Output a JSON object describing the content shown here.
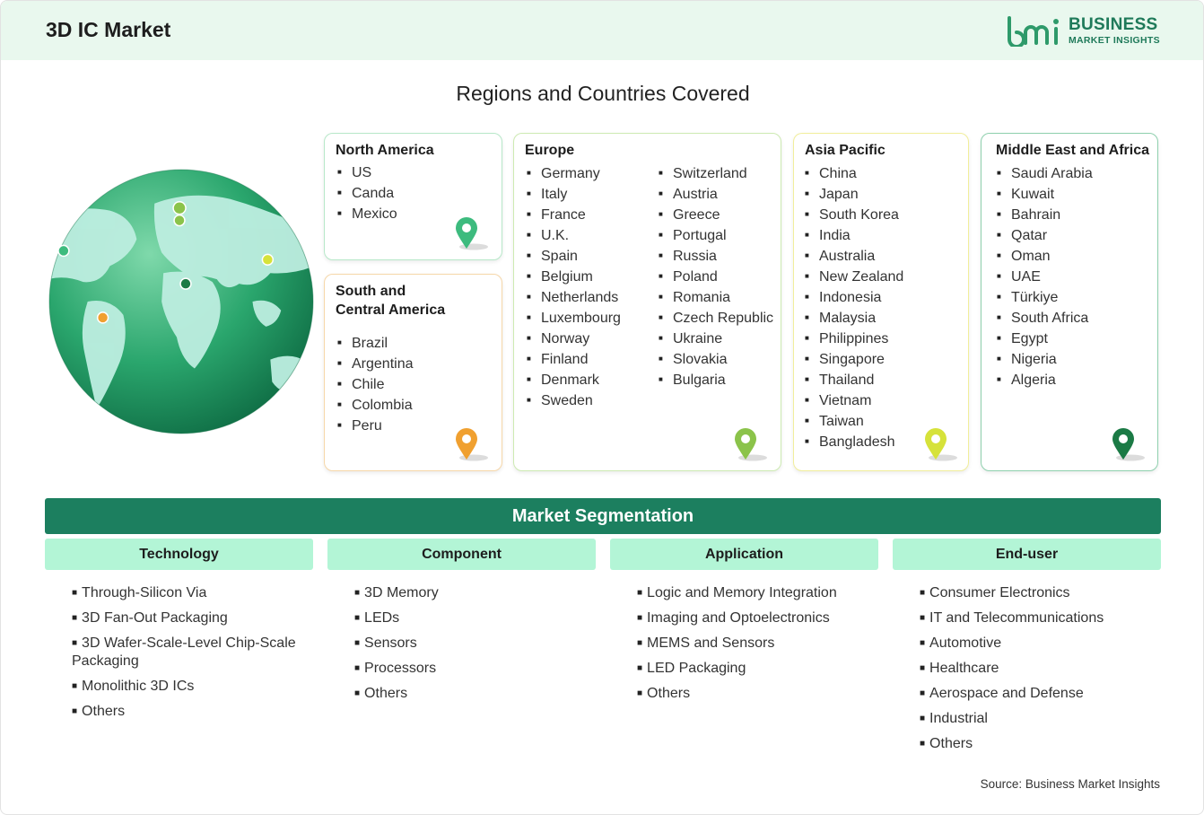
{
  "header": {
    "title": "3D IC Market",
    "logo_word": "BUSINESS",
    "logo_sub": "MARKET INSIGHTS"
  },
  "regions": {
    "title": "Regions and Countries Covered",
    "north_america": {
      "title": "North America",
      "countries": [
        "US",
        "Canda",
        "Mexico"
      ]
    },
    "south_central_america": {
      "title_line1": "South and",
      "title_line2": "Central America",
      "countries": [
        "Brazil",
        "Argentina",
        "Chile",
        "Colombia",
        "Peru"
      ]
    },
    "europe": {
      "title": "Europe",
      "countries_col1": [
        "Germany",
        "Italy",
        "France",
        "U.K.",
        "Spain",
        "Belgium",
        "Netherlands",
        "Luxembourg",
        "Norway",
        "Finland",
        "Denmark",
        "Sweden"
      ],
      "countries_col2": [
        "Switzerland",
        "Austria",
        "Greece",
        "Portugal",
        "Russia",
        "Poland",
        "Romania",
        "Czech Republic",
        "Ukraine",
        "Slovakia",
        "Bulgaria"
      ]
    },
    "asia_pacific": {
      "title": "Asia Pacific",
      "countries": [
        "China",
        "Japan",
        "South Korea",
        "India",
        "Australia",
        "New Zealand",
        "Indonesia",
        "Malaysia",
        "Philippines",
        "Singapore",
        "Thailand",
        "Vietnam",
        "Taiwan",
        "Bangladesh"
      ]
    },
    "middle_east_africa": {
      "title": "Middle East and Africa",
      "countries": [
        "Saudi Arabia",
        "Kuwait",
        "Bahrain",
        "Qatar",
        "Oman",
        "UAE",
        "Türkiye",
        "South Africa",
        "Egypt",
        "Nigeria",
        "Algeria"
      ]
    }
  },
  "segmentation": {
    "title": "Market Segmentation",
    "technology": {
      "label": "Technology",
      "items": [
        "Through-Silicon Via",
        "3D Fan-Out Packaging",
        "3D Wafer-Scale-Level Chip-Scale Packaging",
        "Monolithic 3D ICs",
        "Others"
      ]
    },
    "component": {
      "label": "Component",
      "items": [
        "3D Memory",
        "LEDs",
        "Sensors",
        "Processors",
        "Others"
      ]
    },
    "application": {
      "label": "Application",
      "items": [
        "Logic and Memory Integration",
        "Imaging and Optoelectronics",
        "MEMS and Sensors",
        "LED Packaging",
        "Others"
      ]
    },
    "end_user": {
      "label": "End-user",
      "items": [
        "Consumer Electronics",
        "IT and Telecommunications",
        "Automotive",
        "Healthcare",
        "Aerospace and Defense",
        "Industrial",
        "Others"
      ]
    }
  },
  "source": "Source: Business Market Insights",
  "colors": {
    "header_bg": "#e9f8ee",
    "brand_green": "#1c7f5f",
    "segment_head_bg": "#b3f5d6",
    "pin_north_america": "#3dbb7e",
    "pin_south_central_america": "#f0a030",
    "pin_europe": "#8bc34a",
    "pin_asia_pacific": "#d6e23a",
    "pin_middle_east_africa": "#1b7a45"
  }
}
